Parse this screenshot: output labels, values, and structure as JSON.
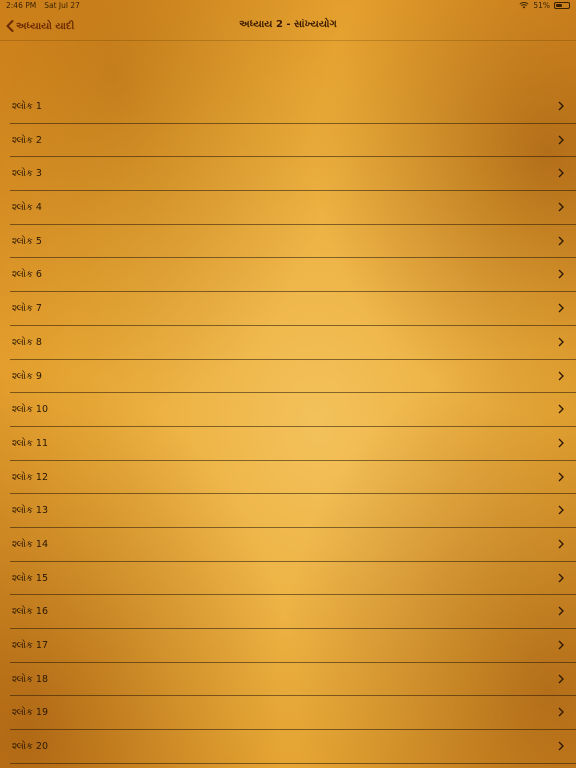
{
  "status_bar": {
    "time": "2:46 PM",
    "date": "Sat Jul 27",
    "battery_text": "51%",
    "battery_level": 0.51
  },
  "nav": {
    "back_label": "અધ્યાયો યાદી",
    "title": "અધ્યાય 2 - સાંખ્યયોગ"
  },
  "rows": [
    {
      "label": "શ્લોક 1"
    },
    {
      "label": "શ્લોક 2"
    },
    {
      "label": "શ્લોક 3"
    },
    {
      "label": "શ્લોક 4"
    },
    {
      "label": "શ્લોક 5"
    },
    {
      "label": "શ્લોક 6"
    },
    {
      "label": "શ્લોક 7"
    },
    {
      "label": "શ્લોક 8"
    },
    {
      "label": "શ્લોક 9"
    },
    {
      "label": "શ્લોક 10"
    },
    {
      "label": "શ્લોક 11"
    },
    {
      "label": "શ્લોક 12"
    },
    {
      "label": "શ્લોક 13"
    },
    {
      "label": "શ્લોક 14"
    },
    {
      "label": "શ્લોક 15"
    },
    {
      "label": "શ્લોક 16"
    },
    {
      "label": "શ્લોક 17"
    },
    {
      "label": "શ્લોક 18"
    },
    {
      "label": "શ્લોક 19"
    },
    {
      "label": "શ્લોક 20"
    }
  ],
  "colors": {
    "accent": "#6b2a00",
    "text": "#2a1800",
    "separator": "#281905"
  },
  "icons": {
    "back": "chevron-left-icon",
    "row": "chevron-right-icon",
    "wifi": "wifi-icon",
    "battery": "battery-icon"
  }
}
